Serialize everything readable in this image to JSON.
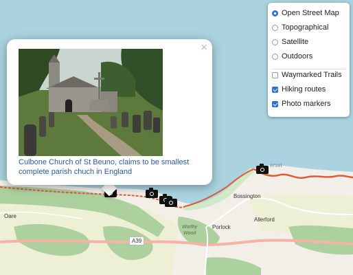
{
  "map": {
    "place_labels": [
      "Oare",
      "Porlock",
      "Allerford",
      "Bossington"
    ],
    "wood_label_lines": [
      "Worthy",
      "Wood"
    ],
    "road_label": "A39",
    "coast_label": "erset"
  },
  "popup": {
    "caption": "Culbone Church of St Beuno, claims to be smallest complete parish chuch in England",
    "close_symbol": "×"
  },
  "layer_control": {
    "base_layers": [
      {
        "label": "Open Street Map",
        "selected": true
      },
      {
        "label": "Topographical",
        "selected": false
      },
      {
        "label": "Satellite",
        "selected": false
      },
      {
        "label": "Outdoors",
        "selected": false
      }
    ],
    "overlays": [
      {
        "label": "Waymarked Trails",
        "checked": false
      },
      {
        "label": "Hiking routes",
        "checked": true
      },
      {
        "label": "Photo markers",
        "checked": true
      }
    ]
  },
  "colors": {
    "sea": "#aad3df",
    "land": "#f2efe9",
    "farmland": "#eef0d5",
    "woodland": "#add19e",
    "route": "#e05a3a",
    "link": "#2a5b9c",
    "accent": "#2a70d8"
  }
}
